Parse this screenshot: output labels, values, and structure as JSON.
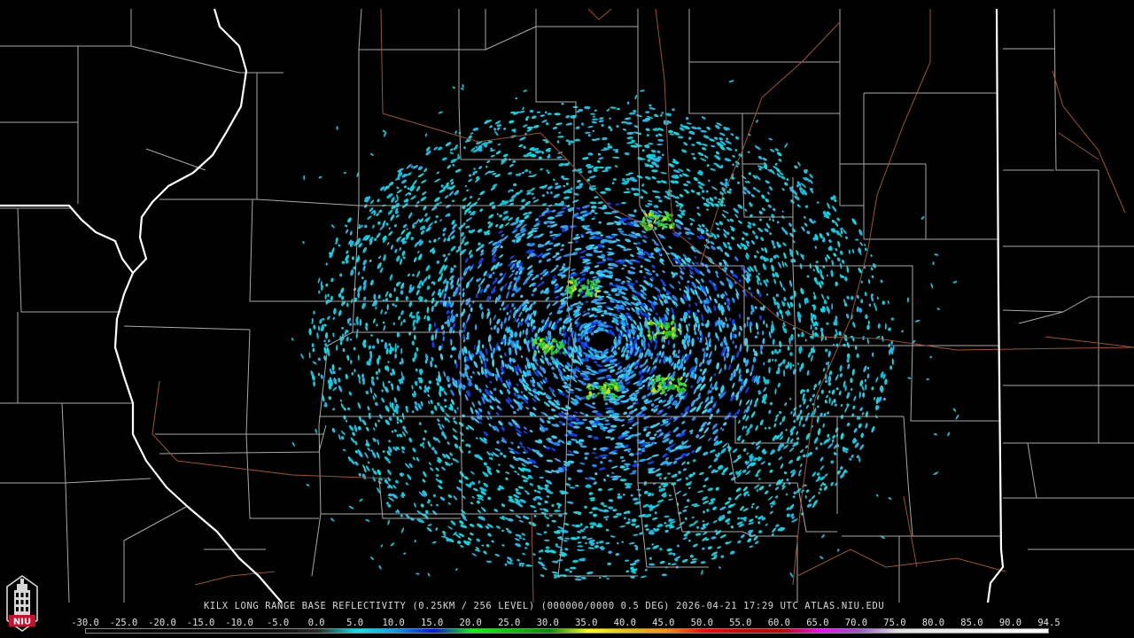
{
  "product": {
    "caption": "KILX LONG RANGE BASE REFLECTIVITY (0.25KM / 256 LEVEL) (000000/0000 0.5 DEG) 2026-04-21 17:29 UTC  ATLAS.NIU.EDU"
  },
  "logo": {
    "text": "NIU",
    "icon": "niu-tower-logo-icon",
    "color": "#c8102e"
  },
  "scale": {
    "labels": [
      "-30.0",
      "-25.0",
      "-20.0",
      "-15.0",
      "-10.0",
      "-5.0",
      "0.0",
      "5.0",
      "10.0",
      "15.0",
      "20.0",
      "25.0",
      "30.0",
      "35.0",
      "40.0",
      "45.0",
      "50.0",
      "55.0",
      "60.0",
      "65.0",
      "70.0",
      "75.0",
      "80.0",
      "85.0",
      "90.0",
      "94.5"
    ],
    "stops": [
      {
        "value": -30,
        "color": "#000000"
      },
      {
        "value": -5,
        "color": "#101010"
      },
      {
        "value": 0,
        "color": "#2a2a2a"
      },
      {
        "value": 5,
        "color": "#00e8e8"
      },
      {
        "value": 10,
        "color": "#00a0f0"
      },
      {
        "value": 15,
        "color": "#0010e0"
      },
      {
        "value": 20,
        "color": "#00ff00"
      },
      {
        "value": 25,
        "color": "#00c800"
      },
      {
        "value": 30,
        "color": "#009000"
      },
      {
        "value": 35,
        "color": "#ffff00"
      },
      {
        "value": 40,
        "color": "#e7c000"
      },
      {
        "value": 45,
        "color": "#ff9000"
      },
      {
        "value": 50,
        "color": "#ff0000"
      },
      {
        "value": 55,
        "color": "#d60000"
      },
      {
        "value": 60,
        "color": "#c00000"
      },
      {
        "value": 65,
        "color": "#ff00ff"
      },
      {
        "value": 70,
        "color": "#9955c9"
      },
      {
        "value": 75,
        "color": "#e0e0e0"
      },
      {
        "value": 94.5,
        "color": "#ffffff"
      }
    ]
  },
  "colors": {
    "state_border": "#ffffff",
    "county_border": "#a8a8a8",
    "highway": "#a0522d",
    "radar_site": "#000000"
  }
}
